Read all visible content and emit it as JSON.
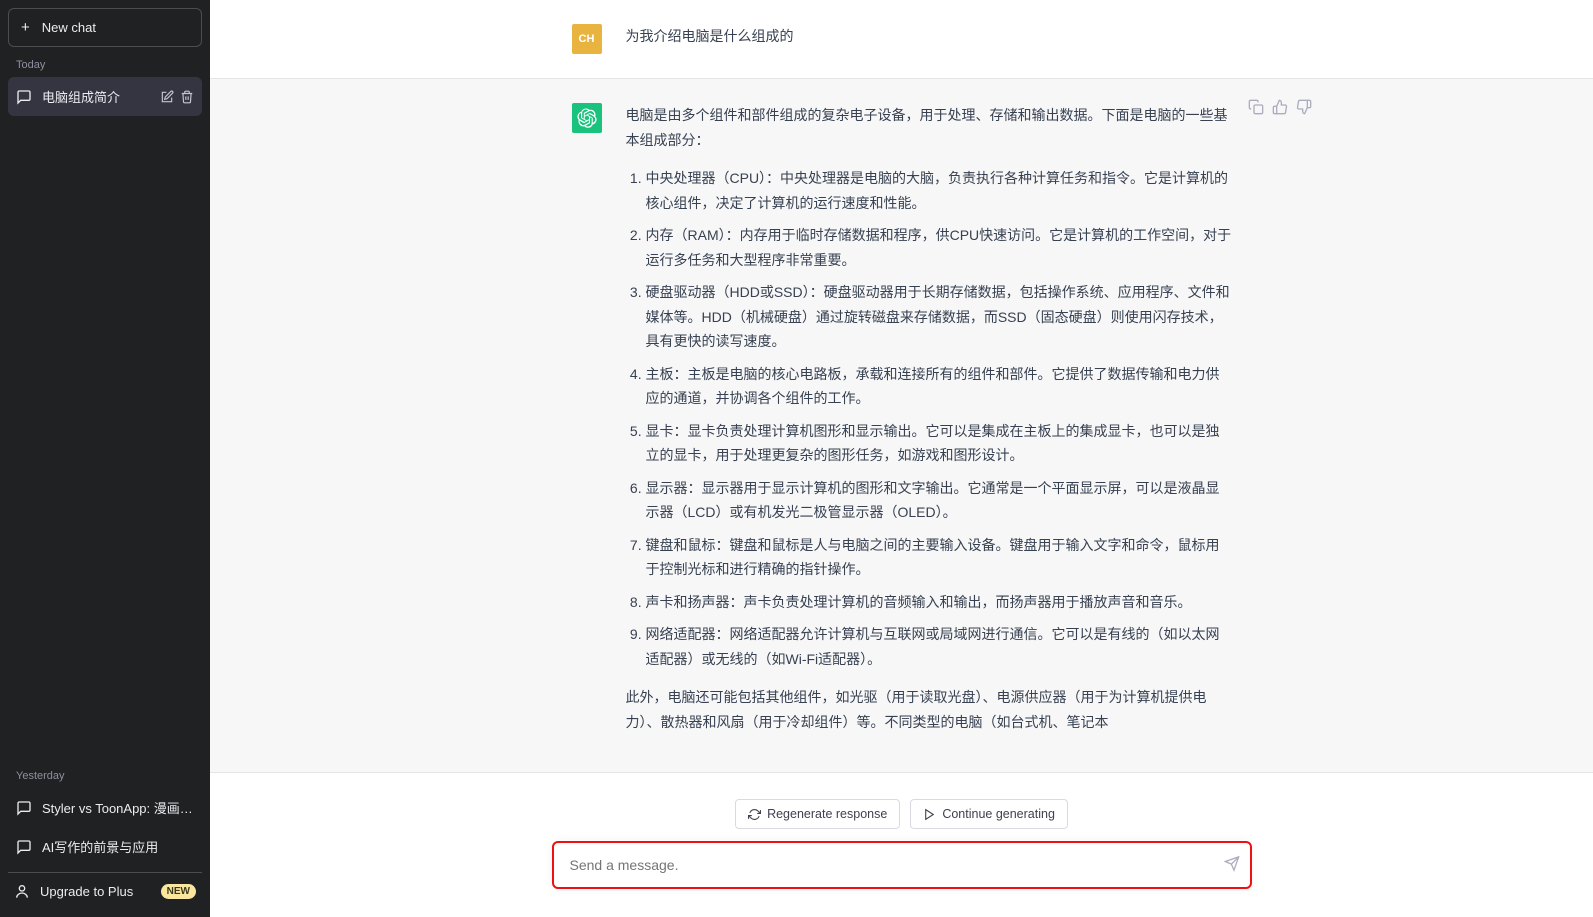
{
  "sidebar": {
    "new_chat_label": "New chat",
    "today_label": "Today",
    "yesterday_label": "Yesterday",
    "today_items": [
      {
        "title": "电脑组成简介",
        "active": true
      }
    ],
    "yesterday_items": [
      {
        "title": "Styler vs ToonApp: 漫画脸优势"
      },
      {
        "title": "AI写作的前景与应用"
      }
    ],
    "upgrade_label": "Upgrade to Plus",
    "upgrade_badge": "NEW"
  },
  "conversation": {
    "user_avatar_text": "CH",
    "user_message": "为我介绍电脑是什么组成的",
    "assistant_intro": "电脑是由多个组件和部件组成的复杂电子设备，用于处理、存储和输出数据。下面是电脑的一些基本组成部分：",
    "assistant_list": [
      "中央处理器（CPU）：中央处理器是电脑的大脑，负责执行各种计算任务和指令。它是计算机的核心组件，决定了计算机的运行速度和性能。",
      "内存（RAM）：内存用于临时存储数据和程序，供CPU快速访问。它是计算机的工作空间，对于运行多任务和大型程序非常重要。",
      "硬盘驱动器（HDD或SSD）：硬盘驱动器用于长期存储数据，包括操作系统、应用程序、文件和媒体等。HDD（机械硬盘）通过旋转磁盘来存储数据，而SSD（固态硬盘）则使用闪存技术，具有更快的读写速度。",
      "主板：主板是电脑的核心电路板，承载和连接所有的组件和部件。它提供了数据传输和电力供应的通道，并协调各个组件的工作。",
      "显卡：显卡负责处理计算机图形和显示输出。它可以是集成在主板上的集成显卡，也可以是独立的显卡，用于处理更复杂的图形任务，如游戏和图形设计。",
      "显示器：显示器用于显示计算机的图形和文字输出。它通常是一个平面显示屏，可以是液晶显示器（LCD）或有机发光二极管显示器（OLED）。",
      "键盘和鼠标：键盘和鼠标是人与电脑之间的主要输入设备。键盘用于输入文字和命令，鼠标用于控制光标和进行精确的指针操作。",
      "声卡和扬声器：声卡负责处理计算机的音频输入和输出，而扬声器用于播放声音和音乐。",
      "网络适配器：网络适配器允许计算机与互联网或局域网进行通信。它可以是有线的（如以太网适配器）或无线的（如Wi-Fi适配器）。"
    ],
    "assistant_outro": "此外，电脑还可能包括其他组件，如光驱（用于读取光盘）、电源供应器（用于为计算机提供电力）、散热器和风扇（用于冷却组件）等。不同类型的电脑（如台式机、笔记本"
  },
  "footer": {
    "regenerate_label": "Regenerate response",
    "continue_label": "Continue generating",
    "input_placeholder": "Send a message."
  }
}
